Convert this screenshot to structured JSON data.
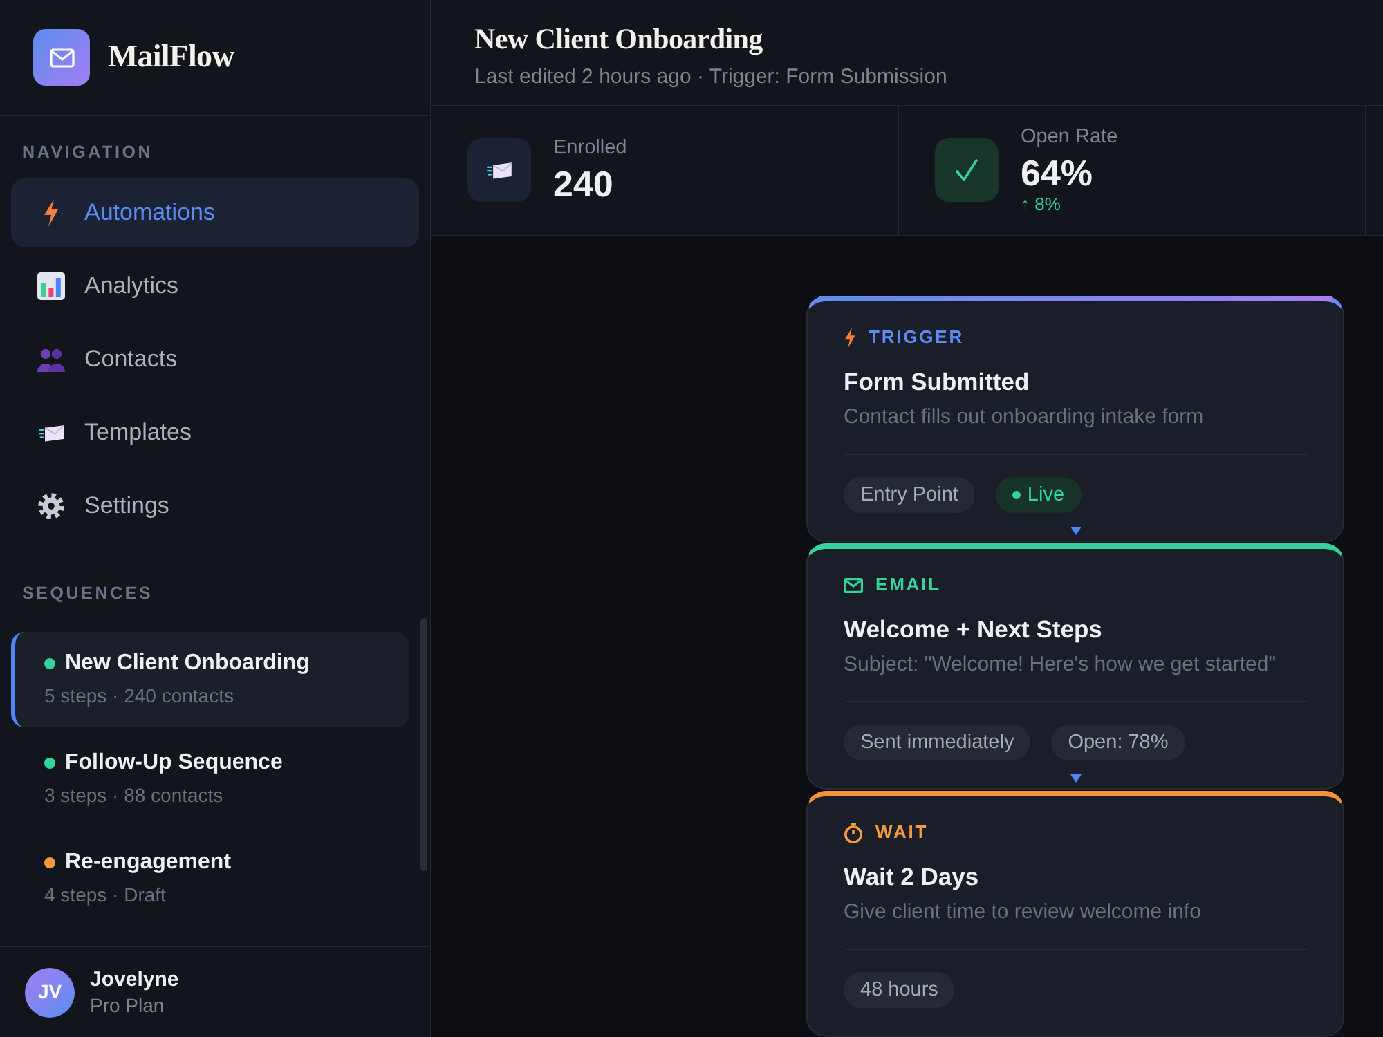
{
  "brand": {
    "name": "MailFlow"
  },
  "sidebar": {
    "nav_heading": "NAVIGATION",
    "nav_items": [
      {
        "label": "Automations",
        "selected": true
      },
      {
        "label": "Analytics",
        "selected": false
      },
      {
        "label": "Contacts",
        "selected": false
      },
      {
        "label": "Templates",
        "selected": false
      },
      {
        "label": "Settings",
        "selected": false
      }
    ],
    "sequences_heading": "SEQUENCES",
    "sequences": [
      {
        "name": "New Client Onboarding",
        "meta": "5 steps · 240 contacts",
        "color": "#34d399",
        "selected": true
      },
      {
        "name": "Follow-Up Sequence",
        "meta": "3 steps · 88 contacts",
        "color": "#34d399",
        "selected": false
      },
      {
        "name": "Re-engagement",
        "meta": "4 steps · Draft",
        "color": "#f59a3c",
        "selected": false
      }
    ]
  },
  "user": {
    "initials": "JV",
    "name": "Jovelyne",
    "plan": "Pro Plan"
  },
  "header": {
    "title": "New Client Onboarding",
    "subtitle": "Last edited 2 hours ago · Trigger: Form Submission"
  },
  "stats": [
    {
      "label": "Enrolled",
      "value": "240"
    },
    {
      "label": "Open Rate",
      "value": "64%",
      "change": "↑ 8%"
    }
  ],
  "steps": [
    {
      "kind": "trigger",
      "label": "TRIGGER",
      "title": "Form Submitted",
      "description": "Contact fills out onboarding intake form",
      "tags": [
        {
          "kind": "plain",
          "text": "Entry Point"
        },
        {
          "kind": "live",
          "text": "Live"
        }
      ]
    },
    {
      "kind": "email",
      "label": "EMAIL",
      "title": "Welcome + Next Steps",
      "description": "Subject: \"Welcome! Here's how we get started\"",
      "tags": [
        {
          "kind": "plain",
          "text": "Sent immediately"
        },
        {
          "kind": "plain",
          "text": "Open: 78%"
        }
      ]
    },
    {
      "kind": "wait",
      "label": "WAIT",
      "title": "Wait 2 Days",
      "description": "Give client time to review welcome info",
      "tags": [
        {
          "kind": "plain",
          "text": "48 hours"
        }
      ]
    }
  ]
}
